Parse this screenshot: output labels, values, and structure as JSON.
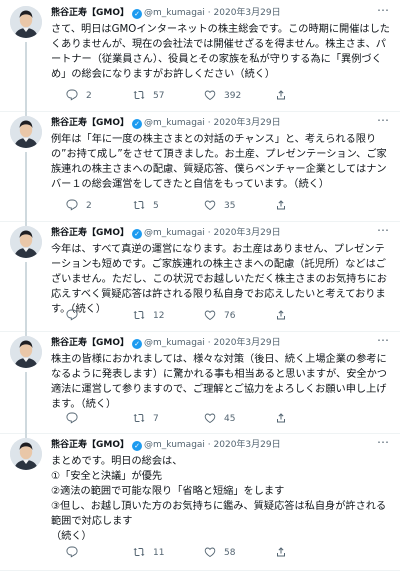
{
  "author": {
    "name": "熊谷正寿【GMO】",
    "handle": "@m_kumagai"
  },
  "tweets": [
    {
      "date": "2020年3月29日",
      "text": "さて、明日はGMOインターネットの株主総会です。この時期に開催はしたくありませんが、現在の会社法では開催せざるを得ません。株主さま、パートナー（従業員さん）、役員とその家族を私が守りする為に「異例づくめ」の総会になりますがお許しください（続く）",
      "replies": "2",
      "retweets": "57",
      "likes": "392"
    },
    {
      "date": "2020年3月29日",
      "text": "例年は「年に一度の株主さまとの対話のチャンス」と、考えられる限りの”お持て成し”をさせて頂きました。お土産、プレゼンテーション、ご家族連れの株主さまへの配慮、質疑応答、僕らベンチャー企業としてはナンバー１の総会運営をしてきたと自信をもっています。（続く）",
      "replies": "2",
      "retweets": "5",
      "likes": "35"
    },
    {
      "date": "2020年3月29日",
      "text": "今年は、すべて真逆の運営になります。お土産はありません、プレゼンテーションも短めです。ご家族連れの株主さまへの配慮（託児所）などはございません。ただし、この状況でお越しいただく株主さまのお気持ちにお応えすべく質疑応答は許される限り私自身でお応えしたいと考えております。（続く）",
      "replies": "",
      "retweets": "12",
      "likes": "76"
    },
    {
      "date": "2020年3月29日",
      "text": "株主の皆様におかれましては、様々な対策（後日、続く上場企業の参考になるように発表します）に驚かれる事も相当あると思いますが、安全かつ適法に運営して参りますので、ご理解とご協力をよろしくお願い申し上げます。（続く）",
      "replies": "",
      "retweets": "7",
      "likes": "45"
    },
    {
      "date": "2020年3月29日",
      "text": "まとめです。明日の総会は、\n①「安全と決議」が優先\n②適法の範囲で可能な限り「省略と短縮」をします\n③但し、お越し頂いた方のお気持ちに鑑み、質疑応答は私自身が許される範囲で対応します\n（続く）",
      "replies": "",
      "retweets": "11",
      "likes": "58"
    }
  ],
  "colors": {
    "text": "#0f1419",
    "meta": "#536471",
    "verified": "#1d9bf0",
    "divider": "#eff3f4"
  },
  "icons": [
    "verified-badge",
    "more-icon",
    "reply-icon",
    "retweet-icon",
    "like-icon",
    "share-icon"
  ]
}
